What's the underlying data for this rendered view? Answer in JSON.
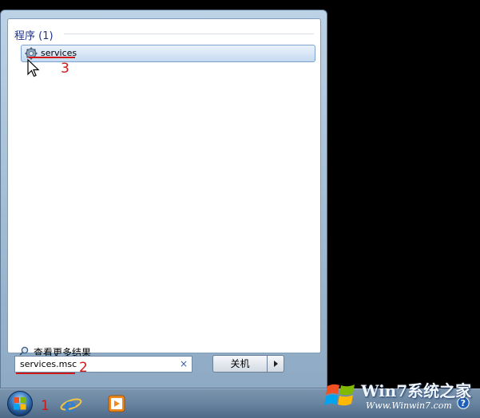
{
  "search_results": {
    "section_title": "程序 (1)",
    "items": [
      {
        "label": "services",
        "icon": "gear-icon"
      }
    ]
  },
  "more_results": {
    "label": "查看更多结果",
    "icon": "magnifier-icon"
  },
  "search": {
    "value": "services.msc",
    "clear_icon": "×"
  },
  "shutdown": {
    "label": "关机"
  },
  "annotations": {
    "start": "1",
    "search": "2",
    "result": "3",
    "color": "#d01818"
  },
  "taskbar": {
    "items": [
      "start-orb-icon",
      "internet-explorer-icon",
      "media-player-icon"
    ]
  },
  "watermark": {
    "title": "Win7系统之家",
    "url": "Www.Winwin7.com"
  }
}
